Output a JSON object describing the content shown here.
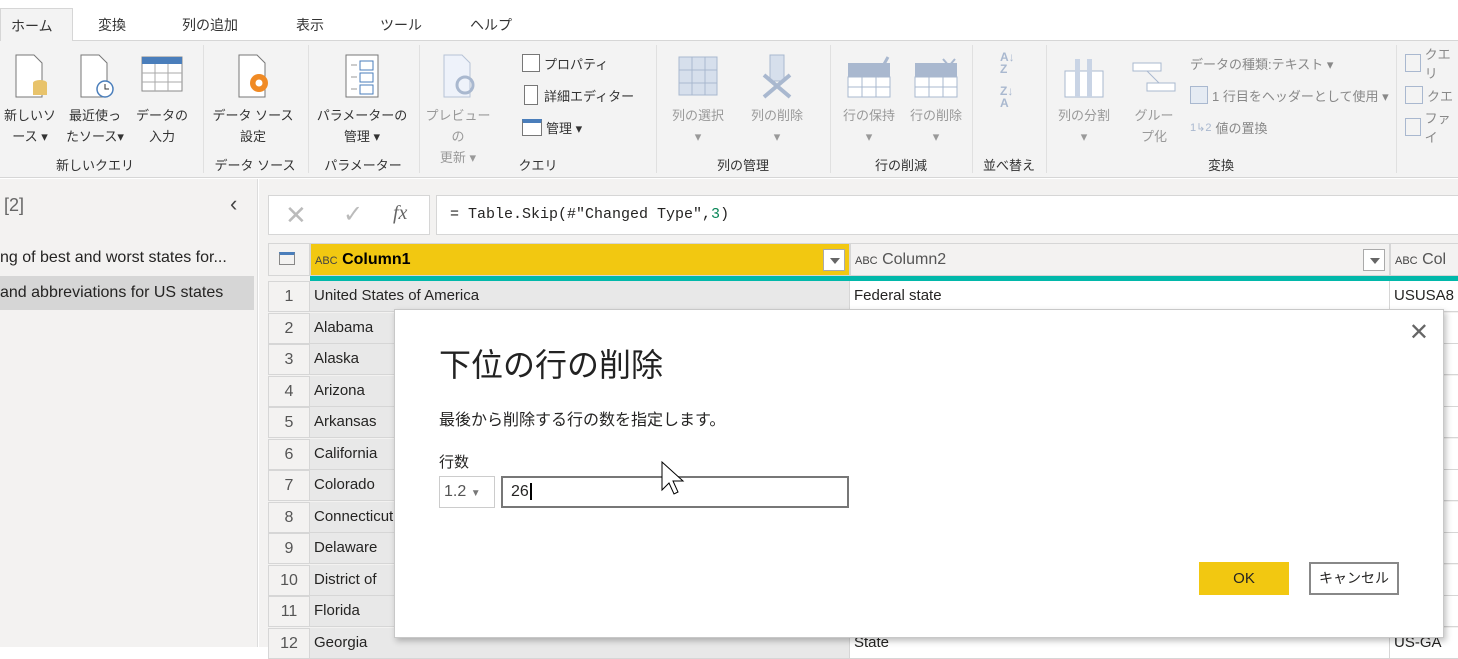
{
  "tabs": [
    "ホーム",
    "変換",
    "列の追加",
    "表示",
    "ツール",
    "ヘルプ"
  ],
  "ribbon": {
    "new_source": [
      "新しいソ",
      "ース ▾"
    ],
    "recent_sources": [
      "最近使っ",
      "たソース▾"
    ],
    "enter_data": [
      "データの",
      "入力"
    ],
    "group_new_query": "新しいクエリ",
    "data_source_settings": [
      "データ ソース",
      "設定"
    ],
    "group_data_sources": "データ ソース",
    "manage_parameters": [
      "パラメーターの",
      "管理 ▾"
    ],
    "group_parameters": "パラメーター",
    "refresh_preview": [
      "プレビューの",
      "更新 ▾"
    ],
    "properties": "プロパティ",
    "advanced_editor": "詳細エディター",
    "manage": "管理 ▾",
    "group_query": "クエリ",
    "choose_columns": [
      "列の選択",
      "▾"
    ],
    "remove_columns": [
      "列の削除",
      "▾"
    ],
    "group_manage_columns": "列の管理",
    "keep_rows": [
      "行の保持",
      "▾"
    ],
    "remove_rows": [
      "行の削除",
      "▾"
    ],
    "group_reduce_rows": "行の削減",
    "group_sort": "並べ替え",
    "split_column": [
      "列の分割",
      "▾"
    ],
    "group_by": [
      "グルー",
      "プ化"
    ],
    "data_type": "データの種類:テキスト ▾",
    "use_first_row": "1 行目をヘッダーとして使用 ▾",
    "replace_values": "値の置換",
    "group_transform": "変換",
    "combine_items": [
      "クエリ",
      "クエ",
      "ファイ"
    ]
  },
  "queries": {
    "count": "[2]",
    "items": [
      "ng of best and worst states for...",
      "and abbreviations for US states"
    ]
  },
  "formula": {
    "prefix": "= Table.Skip(#\"Changed Type\",",
    "arg": "3",
    "suffix": ")"
  },
  "table": {
    "columns": [
      "Column1",
      "Column2",
      "Col"
    ],
    "type_icon": "ABC",
    "rows": [
      {
        "n": "1",
        "c1": "United States of America",
        "c2": "Federal state",
        "c3": "USUSA8"
      },
      {
        "n": "2",
        "c1": "Alabama"
      },
      {
        "n": "3",
        "c1": "Alaska"
      },
      {
        "n": "4",
        "c1": "Arizona"
      },
      {
        "n": "5",
        "c1": "Arkansas"
      },
      {
        "n": "6",
        "c1": "California"
      },
      {
        "n": "7",
        "c1": "Colorado"
      },
      {
        "n": "8",
        "c1": "Connecticut"
      },
      {
        "n": "9",
        "c1": "Delaware"
      },
      {
        "n": "10",
        "c1": "District of"
      },
      {
        "n": "11",
        "c1": "Florida"
      },
      {
        "n": "12",
        "c1": "Georgia",
        "c2": "State",
        "c3": "US-GA"
      }
    ]
  },
  "dialog": {
    "title": "下位の行の削除",
    "description": "最後から削除する行の数を指定します。",
    "field_label": "行数",
    "type_select": "1.2",
    "value": "26",
    "ok": "OK",
    "cancel": "キャンセル"
  },
  "colors": {
    "accent": "#f2c811",
    "teal": "#01b8aa"
  }
}
